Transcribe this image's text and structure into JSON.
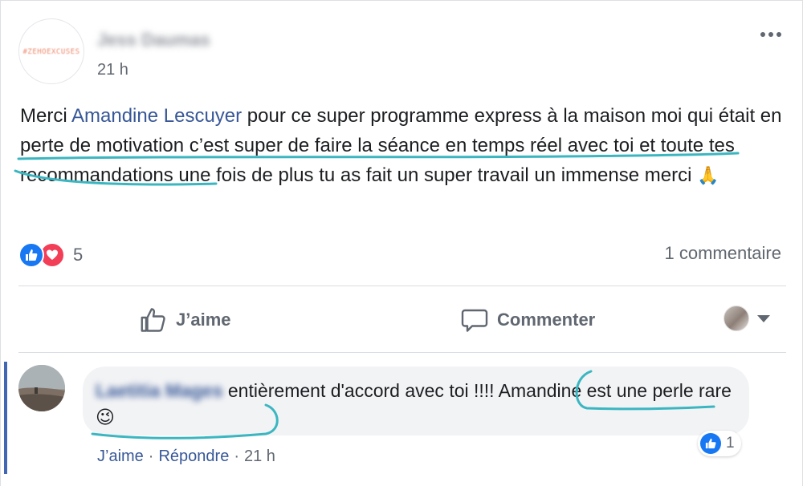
{
  "post": {
    "author": "Jess Daumas",
    "avatar_text": "#ZEHOEXCUSES",
    "timestamp": "21 h",
    "text_before_mention": "Merci ",
    "mention": "Amandine Lescuyer",
    "text_after_mention": " pour ce super programme express à la maison moi qui était en perte de motivation c’est super de faire la séance en temps réel avec toi et toute tes recommandations une fois de plus tu as fait un super travail un immense merci ",
    "emoji": "🙏",
    "reaction_count": "5",
    "comment_count": "1 commentaire"
  },
  "actions": {
    "like_label": "J’aime",
    "comment_label": "Commenter"
  },
  "comment": {
    "author": "Laetitia Mages",
    "text": "entièrement d'accord avec toi !!!! Amandine est une perle rare ",
    "emoji": "😉",
    "reaction_count": "1",
    "like_label": "J’aime",
    "reply_label": "Répondre",
    "separator": "·",
    "timestamp": "21 h"
  },
  "colors": {
    "link": "#385898",
    "like_blue": "#1877f2",
    "love_red": "#f33e58",
    "annotation_teal": "#3bb6c1",
    "secondary_text": "#606770"
  },
  "icons": [
    "more-options-icon",
    "like-reaction-icon",
    "love-reaction-icon",
    "thumbs-up-icon",
    "comment-bubble-icon",
    "audience-caret-icon"
  ]
}
